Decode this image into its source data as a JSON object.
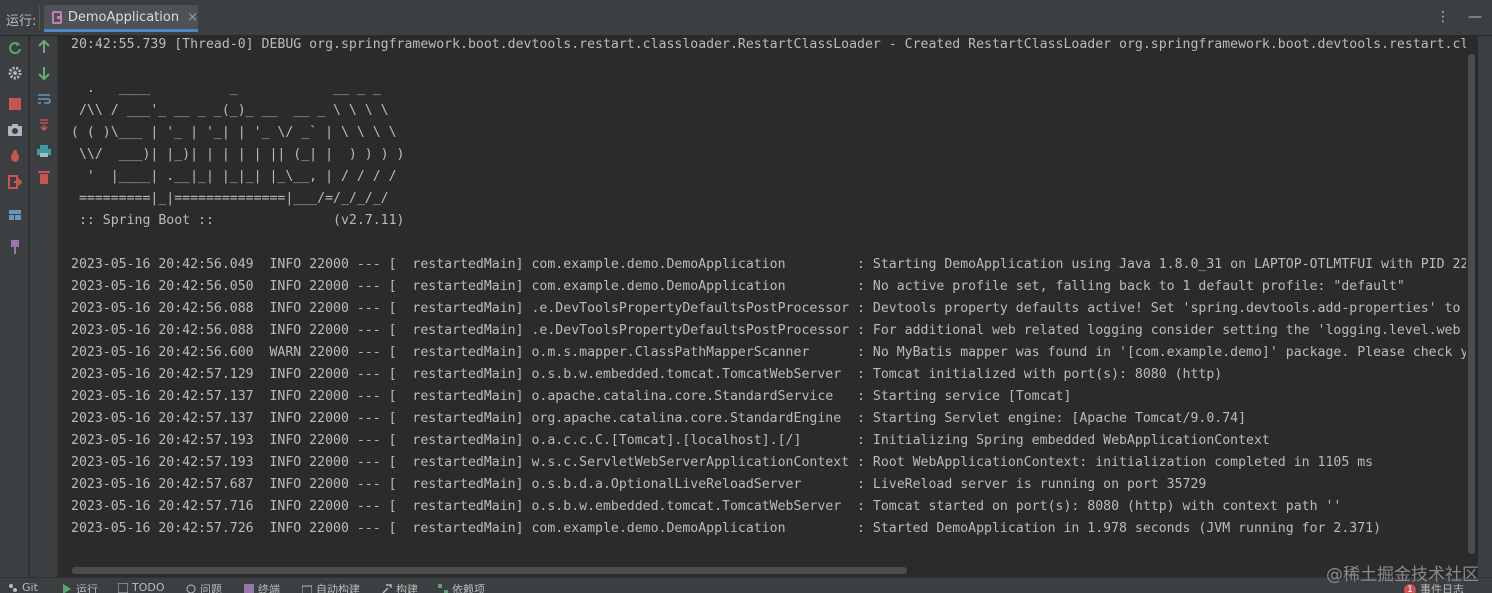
{
  "window": {
    "run_label": "运行:",
    "tab_title": "DemoApplication",
    "tab_close": "×",
    "more_icon": "⋮",
    "minimize_icon": "—"
  },
  "console": {
    "lines": [
      "20:42:55.739 [Thread-0] DEBUG org.springframework.boot.devtools.restart.classloader.RestartClassLoader - Created RestartClassLoader org.springframework.boot.devtools.restart.cl",
      "",
      "  .   ____          _            __ _ _",
      " /\\\\ / ___'_ __ _ _(_)_ __  __ _ \\ \\ \\ \\",
      "( ( )\\___ | '_ | '_| | '_ \\/ _` | \\ \\ \\ \\",
      " \\\\/  ___)| |_)| | | | | || (_| |  ) ) ) )",
      "  '  |____| .__|_| |_|_| |_\\__, | / / / /",
      " =========|_|==============|___/=/_/_/_/",
      " :: Spring Boot ::               (v2.7.11)",
      "",
      "2023-05-16 20:42:56.049  INFO 22000 --- [  restartedMain] com.example.demo.DemoApplication         : Starting DemoApplication using Java 1.8.0_31 on LAPTOP-OTLMTFUI with PID 22",
      "2023-05-16 20:42:56.050  INFO 22000 --- [  restartedMain] com.example.demo.DemoApplication         : No active profile set, falling back to 1 default profile: \"default\"",
      "2023-05-16 20:42:56.088  INFO 22000 --- [  restartedMain] .e.DevToolsPropertyDefaultsPostProcessor : Devtools property defaults active! Set 'spring.devtools.add-properties' to",
      "2023-05-16 20:42:56.088  INFO 22000 --- [  restartedMain] .e.DevToolsPropertyDefaultsPostProcessor : For additional web related logging consider setting the 'logging.level.web",
      "2023-05-16 20:42:56.600  WARN 22000 --- [  restartedMain] o.m.s.mapper.ClassPathMapperScanner      : No MyBatis mapper was found in '[com.example.demo]' package. Please check y",
      "2023-05-16 20:42:57.129  INFO 22000 --- [  restartedMain] o.s.b.w.embedded.tomcat.TomcatWebServer  : Tomcat initialized with port(s): 8080 (http)",
      "2023-05-16 20:42:57.137  INFO 22000 --- [  restartedMain] o.apache.catalina.core.StandardService   : Starting service [Tomcat]",
      "2023-05-16 20:42:57.137  INFO 22000 --- [  restartedMain] org.apache.catalina.core.StandardEngine  : Starting Servlet engine: [Apache Tomcat/9.0.74]",
      "2023-05-16 20:42:57.193  INFO 22000 --- [  restartedMain] o.a.c.c.C.[Tomcat].[localhost].[/]       : Initializing Spring embedded WebApplicationContext",
      "2023-05-16 20:42:57.193  INFO 22000 --- [  restartedMain] w.s.c.ServletWebServerApplicationContext : Root WebApplicationContext: initialization completed in 1105 ms",
      "2023-05-16 20:42:57.687  INFO 22000 --- [  restartedMain] o.s.b.d.a.OptionalLiveReloadServer       : LiveReload server is running on port 35729",
      "2023-05-16 20:42:57.716  INFO 22000 --- [  restartedMain] o.s.b.w.embedded.tomcat.TomcatWebServer  : Tomcat started on port(s): 8080 (http) with context path ''",
      "2023-05-16 20:42:57.726  INFO 22000 --- [  restartedMain] com.example.demo.DemoApplication         : Started DemoApplication in 1.978 seconds (JVM running for 2.371)"
    ]
  },
  "left_toolbar": {
    "col1_icons": [
      "rerun-icon",
      "settings-icon",
      "stop-icon",
      "camera-icon",
      "debug-icon",
      "exit-icon",
      "layout-icon",
      "pin-icon"
    ],
    "col2_icons": [
      "arrow-up-icon",
      "arrow-down-icon",
      "soft-wrap-icon",
      "scroll-to-end-icon",
      "print-icon",
      "trash-icon"
    ]
  },
  "bottom_bar": {
    "items": [
      {
        "label": "Git",
        "icon": "git-icon"
      },
      {
        "label": "运行",
        "icon": "run-icon"
      },
      {
        "label": "TODO",
        "icon": "todo-icon"
      },
      {
        "label": "问题",
        "icon": "problems-icon"
      },
      {
        "label": "终端",
        "icon": "terminal-icon"
      },
      {
        "label": "自动构建",
        "icon": "build-icon"
      },
      {
        "label": "构建",
        "icon": "hammer-icon"
      },
      {
        "label": "依赖项",
        "icon": "dependency-icon"
      }
    ],
    "watermark": "@稀土掘金技术社区",
    "event_badge": "1",
    "event_log": "事件日志"
  },
  "colors": {
    "background": "#2b2b2b",
    "panel": "#3c3f41",
    "text": "#bbbbbb",
    "accent": "#4a88c7"
  }
}
